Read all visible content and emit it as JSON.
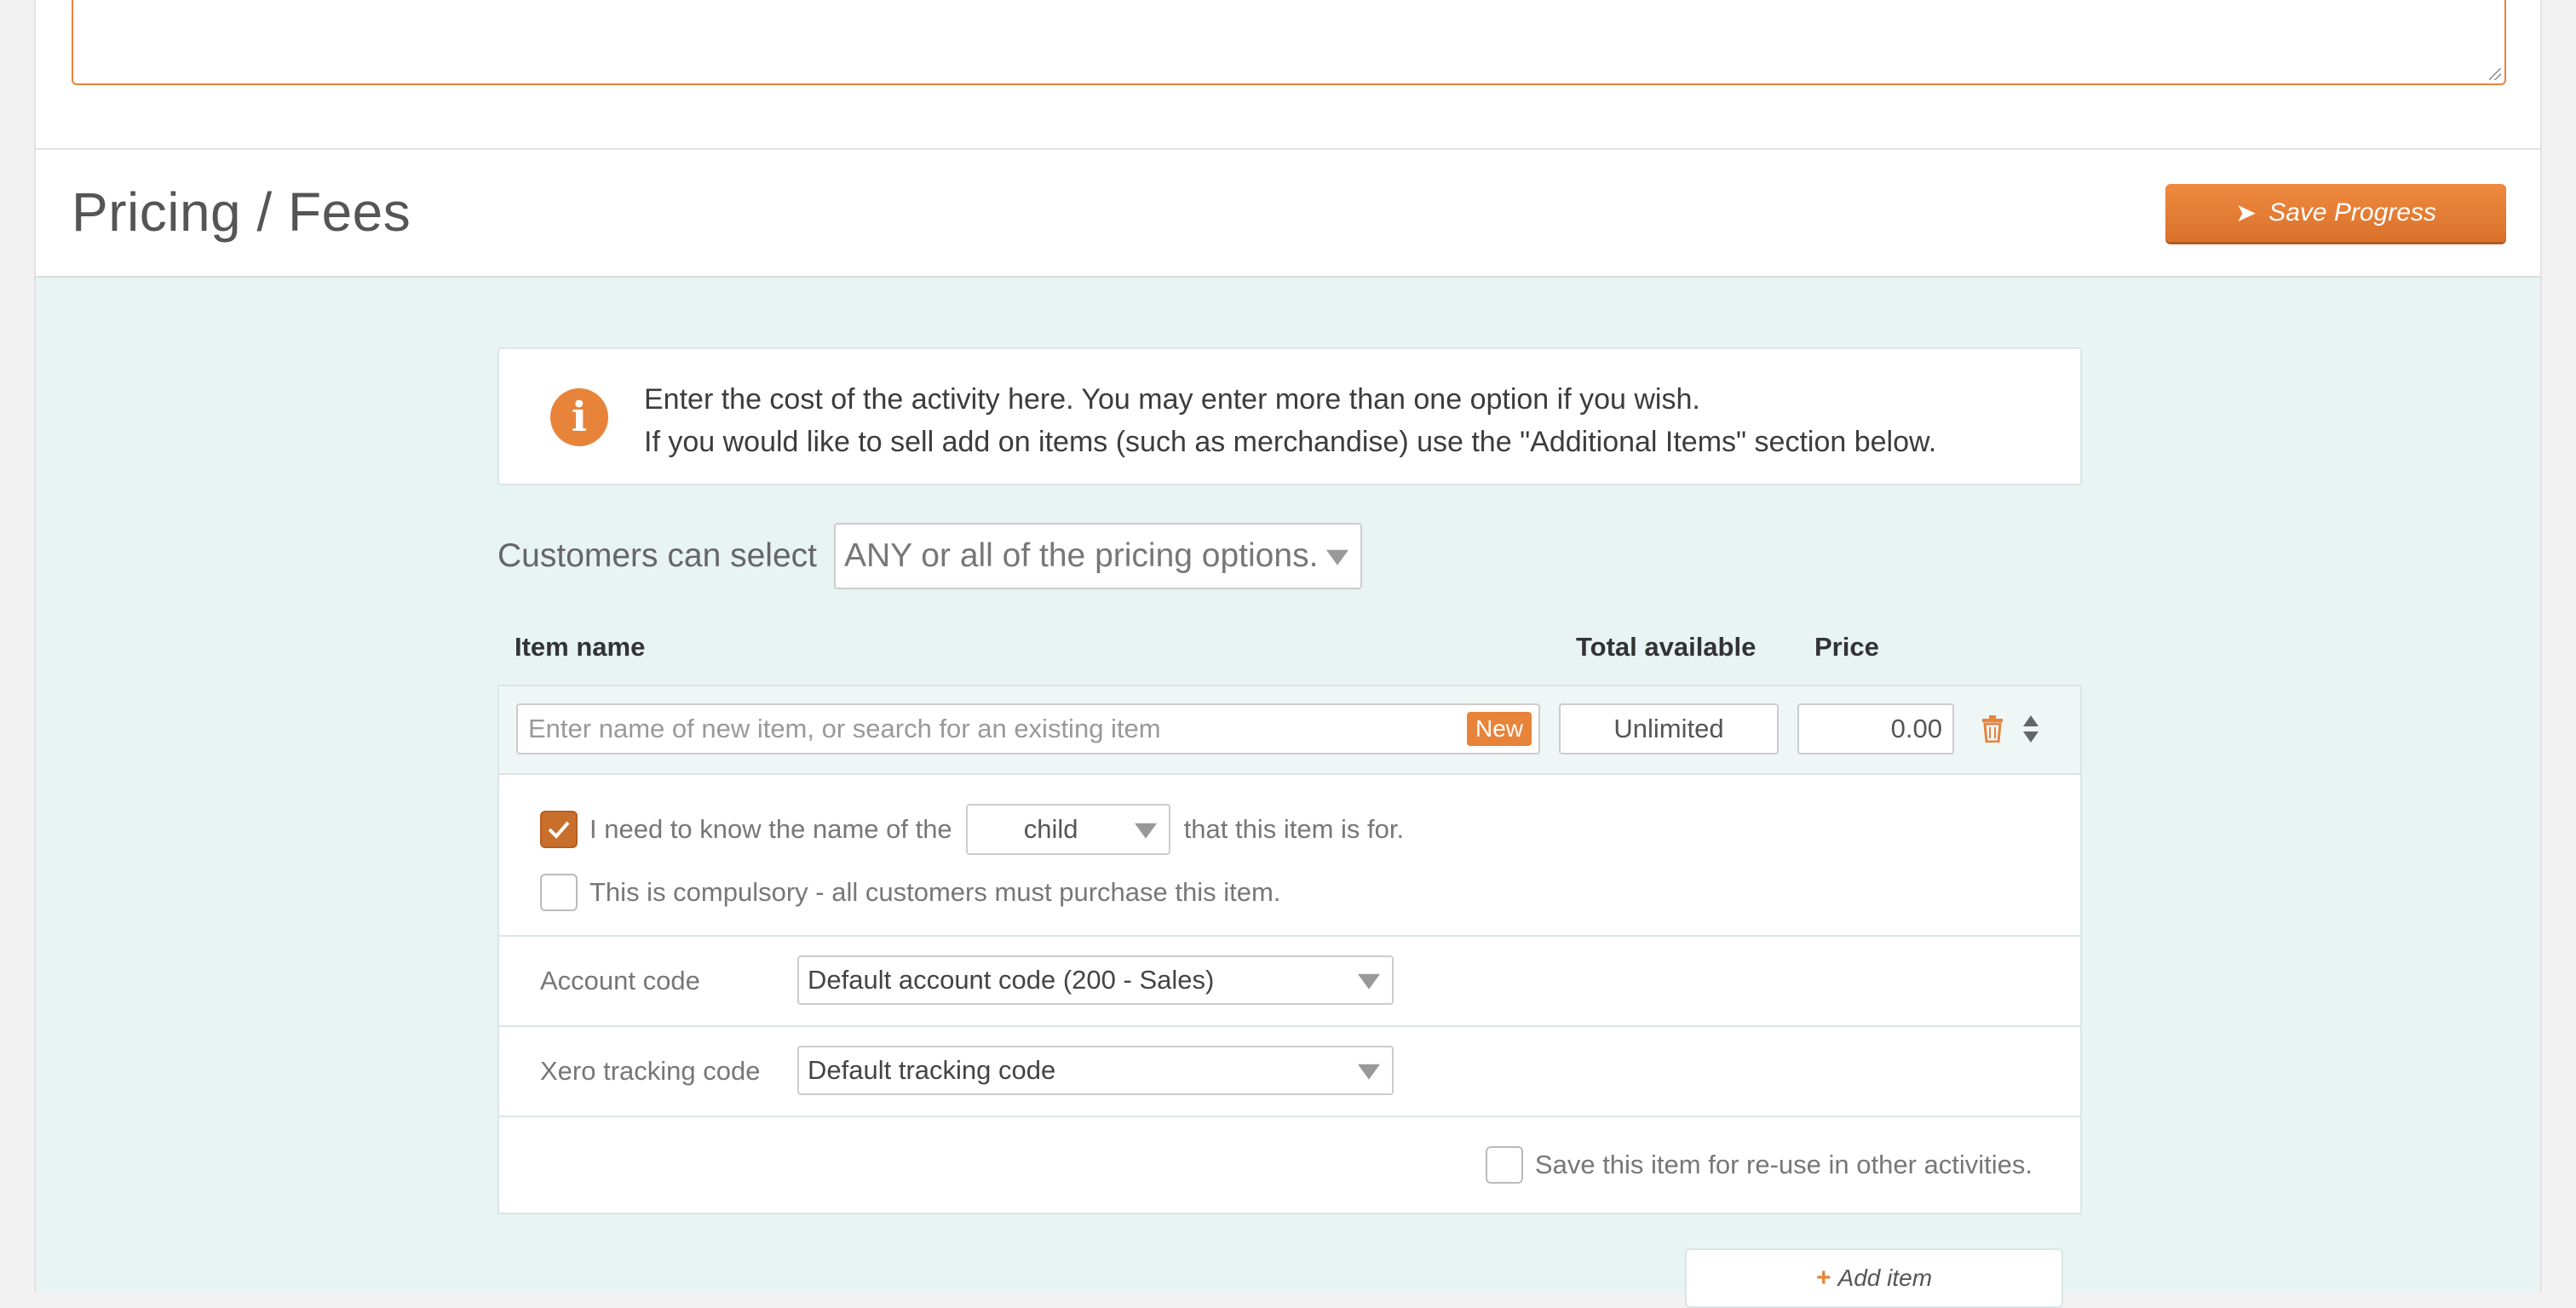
{
  "section": {
    "title": "Pricing / Fees",
    "save_button": "Save Progress"
  },
  "info": {
    "line1": "Enter the cost of the activity here. You may enter more than one option if you wish.",
    "line2": "If you would like to sell add on items (such as merchandise) use the \"Additional Items\" section below."
  },
  "pricing_select": {
    "label": "Customers can select",
    "value": "ANY or all of the pricing options."
  },
  "columns": {
    "item_name": "Item name",
    "total_available": "Total available",
    "price": "Price"
  },
  "item": {
    "name_placeholder": "Enter name of new item, or search for an existing item",
    "new_badge": "New",
    "total_available": "Unlimited",
    "price": "0.00",
    "need_name_prefix": "I need to know the name of the",
    "need_name_select": "child",
    "need_name_suffix": "that this item is for.",
    "need_name_checked": true,
    "compulsory_label": "This is compulsory - all customers must purchase this item.",
    "compulsory_checked": false,
    "account_code_label": "Account code",
    "account_code_value": "Default account code (200 - Sales)",
    "tracking_code_label": "Xero tracking code",
    "tracking_code_value": "Default tracking code",
    "save_reuse_label": "Save this item for re-use in other activities.",
    "save_reuse_checked": false
  },
  "add_item_button": "Add item",
  "colors": {
    "accent": "#e8833a",
    "background": "#e8f3f3"
  }
}
